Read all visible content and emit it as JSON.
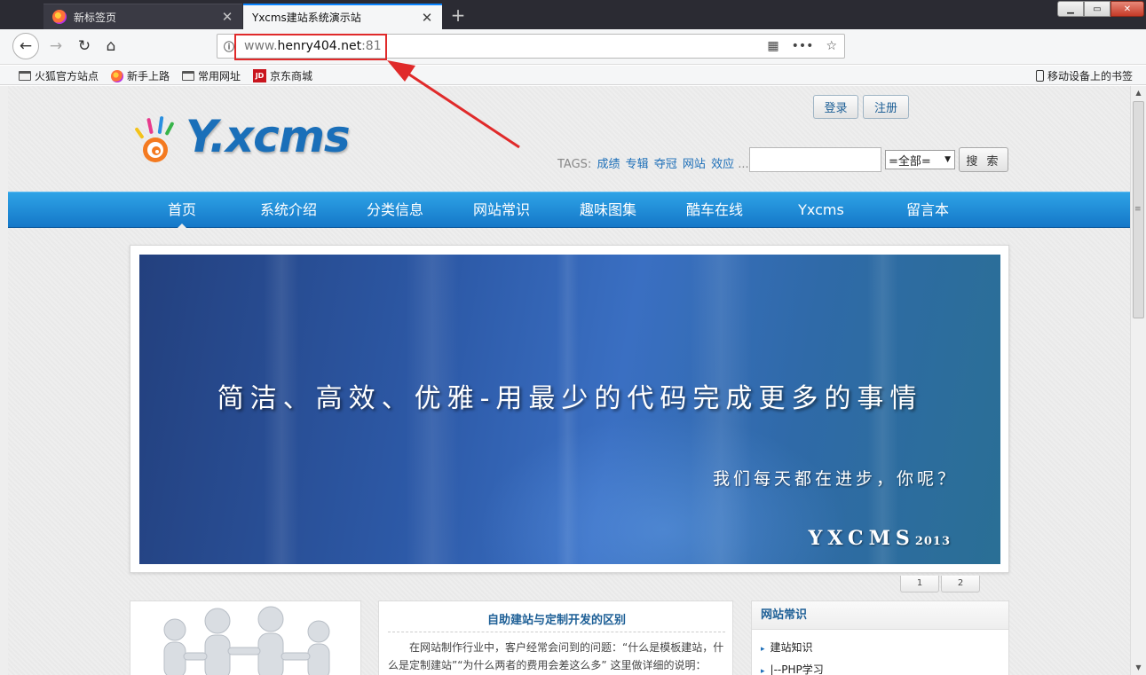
{
  "browser": {
    "tabs": [
      {
        "title": "新标签页",
        "active": false
      },
      {
        "title": "Yxcms建站系统演示站",
        "active": true
      }
    ],
    "url": {
      "prefix": "www.",
      "domain": "henry404.net",
      "suffix": ":81"
    },
    "bookmarks": [
      "火狐官方站点",
      "新手上路",
      "常用网址",
      "京东商城"
    ],
    "mobile_bookmarks": "移动设备上的书签",
    "jd_icon": "JD",
    "annotation_color": "#e02a2a"
  },
  "site": {
    "logo_text": "Y.xcms",
    "auth": {
      "login": "登录",
      "register": "注册"
    },
    "tags_label": "TAGS:",
    "tags": [
      "成绩",
      "专辑",
      "夺冠",
      "网站",
      "效应"
    ],
    "tags_more": "...",
    "search": {
      "scope": "=全部=",
      "button": "搜 索",
      "value": ""
    },
    "nav": [
      "首页",
      "系统介绍",
      "分类信息",
      "网站常识",
      "趣味图集",
      "酷车在线",
      "Yxcms",
      "留言本"
    ],
    "banner": {
      "slogan": "简洁、高效、优雅-用最少的代码完成更多的事情",
      "sub": "我们每天都在进步，你呢？",
      "brand": "YXCMS",
      "year": "2013"
    },
    "pager": [
      "1",
      "2"
    ],
    "article": {
      "title": "自助建站与定制开发的区别",
      "text": "在网站制作行业中，客户经常会问到的问题：“什么是模板建站，什么是定制建站”“为什么两者的费用会差这么多” 这里做详细的说明："
    },
    "sidebar": {
      "title": "网站常识",
      "items": [
        "建站知识",
        "|--PHP学习"
      ]
    },
    "colors": {
      "nav": "#1e8ad8",
      "link": "#1d6fb8"
    }
  }
}
